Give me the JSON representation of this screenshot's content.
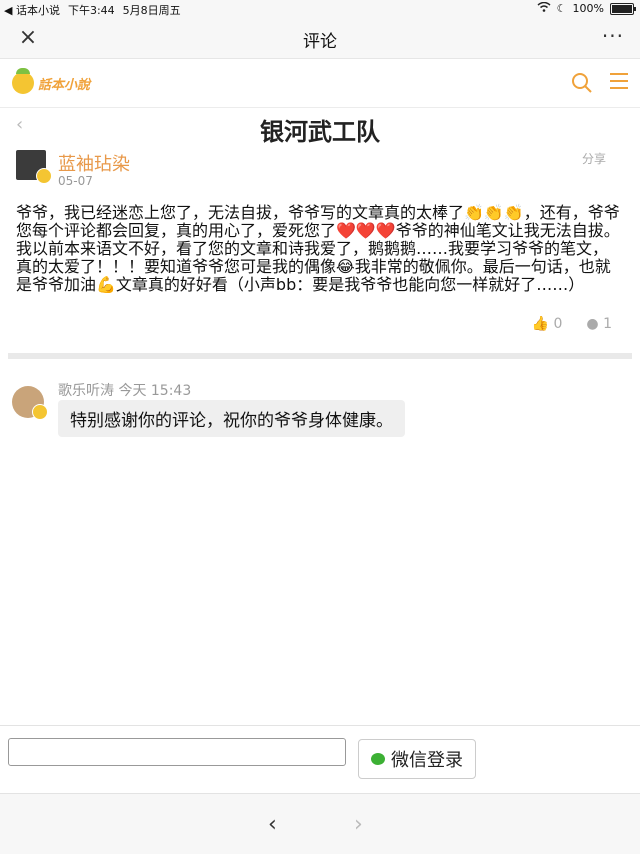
{
  "status_bar": {
    "app": "◀ 话本小说",
    "time": "下午3:44",
    "date": "5月8日周五",
    "battery": "100%"
  },
  "navbar": {
    "close_icon": "×",
    "title": "评论",
    "more_icon": "···"
  },
  "site": {
    "logo_text": "話本小說",
    "accent_color": "#f0a23a"
  },
  "chapter": {
    "back_icon": "‹",
    "title": "银河武工队"
  },
  "comment": {
    "author": "蓝袖玷染",
    "date": "05-07",
    "share_label": "分享",
    "body": "爷爷，我已经迷恋上您了，无法自拔，爷爷写的文章真的太棒了👏👏👏，还有，爷爷您每个评论都会回复，真的用心了，爱死您了❤️❤️❤️爷爷的神仙笔文让我无法自拔。我以前本来语文不好，看了您的文章和诗我爱了，鹅鹅鹅……我要学习爷爷的笔文，真的太爱了！！！要知道爷爷您可是我的偶像😂我非常的敬佩你。最后一句话，也就是爷爷加油💪文章真的好好看（小声bb：要是我爷爷也能向您一样就好了……）",
    "likes": "0",
    "replies": "1"
  },
  "reply": {
    "author_time": "歌乐听涛 今天 15:43",
    "text": "特别感谢你的评论，祝你的爷爷身体健康。"
  },
  "bottom": {
    "input_value": "",
    "login_label": "微信登录"
  },
  "pager": {
    "prev_icon": "‹",
    "next_icon": "›"
  }
}
